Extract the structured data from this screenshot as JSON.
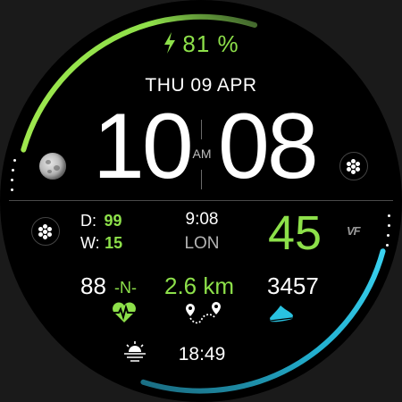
{
  "battery": {
    "percent_text": "81 %",
    "icon": "charging-bolt-icon",
    "color": "#8de04a"
  },
  "date": "THU 09 APR",
  "time": {
    "hour": "10",
    "minute": "08",
    "ampm": "AM"
  },
  "left_panel": {
    "d_label": "D:",
    "d_value": "99",
    "w_label": "W:",
    "w_value": "15"
  },
  "world_clock": {
    "time": "9:08",
    "city": "LON"
  },
  "big_number": "45",
  "vf_logo": "VF",
  "stats": {
    "heart_rate": "88",
    "heart_unit": "-N-",
    "distance": "2.6 km",
    "steps": "3457"
  },
  "sunrise_time": "18:49",
  "icons": {
    "moon": "moon-phase-icon",
    "apps_left": "app-shortcut-icon",
    "apps_right": "app-shortcut-icon",
    "heart": "heart-rate-icon",
    "route": "route-icon",
    "shoe": "shoe-icon",
    "sun": "sunrise-icon"
  },
  "colors": {
    "accent_green": "#8de04a",
    "accent_cyan": "#29c2e0"
  },
  "progress": {
    "top_arc_fraction": 0.81,
    "bottom_arc_fraction": 0.45
  }
}
